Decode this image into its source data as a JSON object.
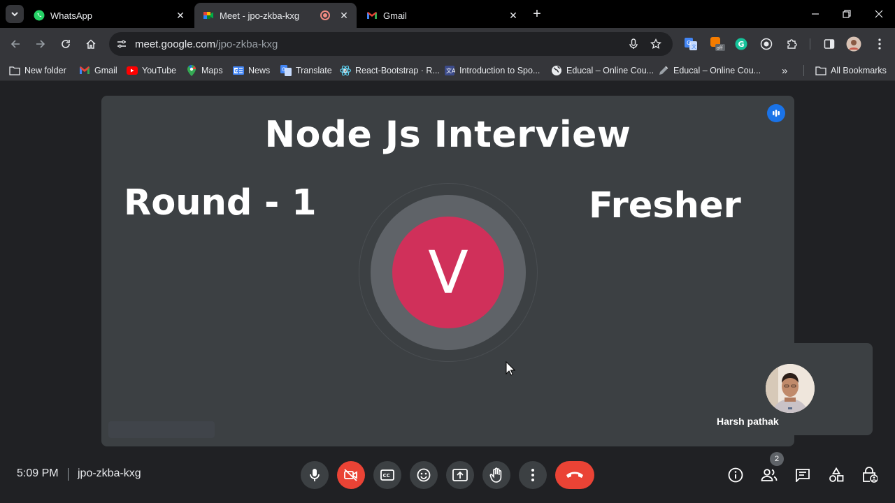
{
  "browser": {
    "tabs": [
      {
        "title": "WhatsApp",
        "icon": "whatsapp-icon",
        "active": false
      },
      {
        "title": "Meet - jpo-zkba-kxg",
        "icon": "meet-icon",
        "active": true,
        "recording": true
      },
      {
        "title": "Gmail",
        "icon": "gmail-icon",
        "active": false
      }
    ],
    "url_host": "meet.google.com",
    "url_path": "/jpo-zkba-kxg",
    "bookmarks": [
      {
        "label": "New folder",
        "icon": "folder-icon"
      },
      {
        "label": "Gmail",
        "icon": "gmail-icon"
      },
      {
        "label": "YouTube",
        "icon": "youtube-icon"
      },
      {
        "label": "Maps",
        "icon": "maps-icon"
      },
      {
        "label": "News",
        "icon": "news-icon"
      },
      {
        "label": "Translate",
        "icon": "translate-icon"
      },
      {
        "label": "React-Bootstrap · R...",
        "icon": "react-bootstrap-icon"
      },
      {
        "label": "Introduction to Spo...",
        "icon": "spotify-doc-icon"
      },
      {
        "label": "Educal – Online Cou...",
        "icon": "globe-icon"
      },
      {
        "label": "Educal – Online Cou...",
        "icon": "pencil-icon"
      }
    ],
    "all_bookmarks": "All Bookmarks",
    "extension_badge": "off"
  },
  "meet": {
    "slide": {
      "title": "Node Js Interview",
      "left_text": "Round - 1",
      "right_text": "Fresher"
    },
    "main_avatar_letter": "V",
    "self_name": "Harsh pathak",
    "time": "5:09 PM",
    "meeting_code": "jpo-zkba-kxg",
    "participants_count": "2",
    "colors": {
      "avatar": "#d0305a",
      "end_call": "#ea4335",
      "speaking": "#1a73e8"
    }
  }
}
